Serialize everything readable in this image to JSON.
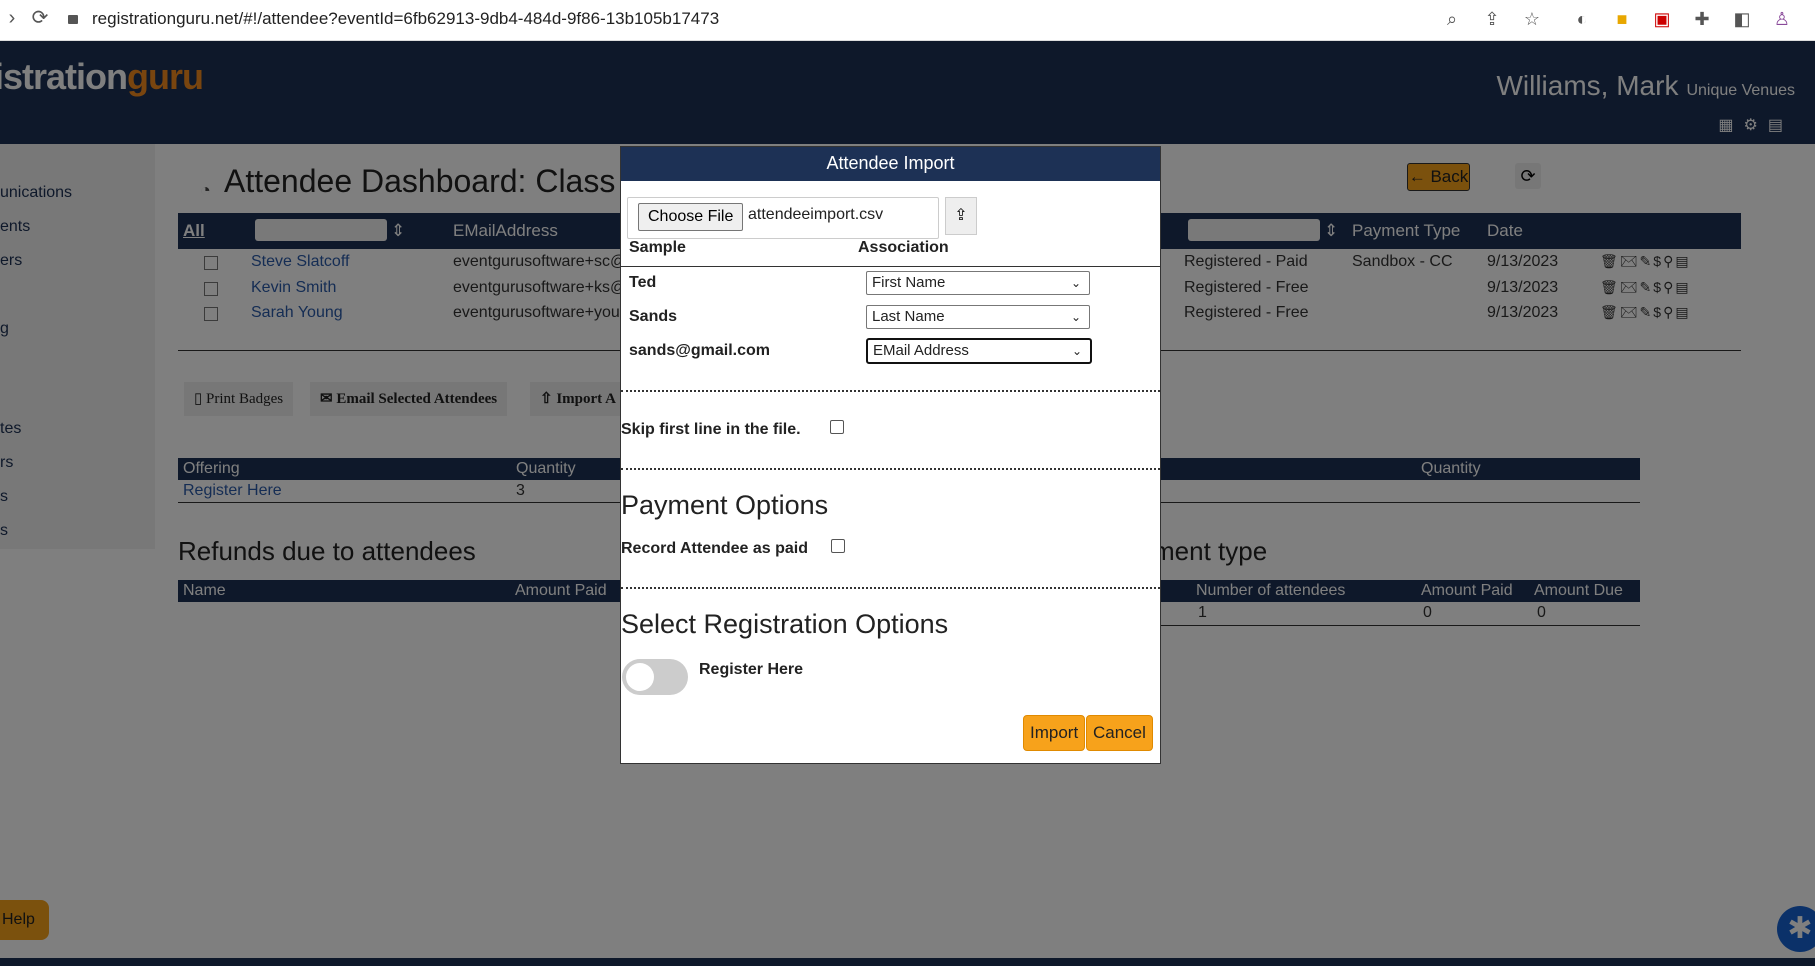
{
  "browser": {
    "url": "registrationguru.net/#!/attendee?eventId=6fb62913-9db4-484d-9f86-13b105b17473"
  },
  "app": {
    "logo_main": "istration",
    "logo_guru": "guru",
    "user_name": "Williams, Mark",
    "org": "Unique Venues",
    "sidebar": [
      "unications",
      "ents",
      "ers",
      "g",
      "tes",
      "rs",
      "s",
      "s"
    ],
    "page_title": "Attendee Dashboard: Class",
    "back_label": "Back",
    "grid": {
      "all_label": "All",
      "col_email": "EMailAddress",
      "col_payment": "Payment Type",
      "col_date": "Date",
      "rows": [
        {
          "name": "Steve Slatcoff",
          "email": "eventgurusoftware+sc@",
          "status": "Registered - Paid",
          "payment": "Sandbox - CC",
          "date": "9/13/2023"
        },
        {
          "name": "Kevin Smith",
          "email": "eventgurusoftware+ks@",
          "status": "Registered - Free",
          "payment": "",
          "date": "9/13/2023"
        },
        {
          "name": "Sarah Young",
          "email": "eventgurusoftware+you",
          "status": "Registered - Free",
          "payment": "",
          "date": "9/13/2023"
        }
      ]
    },
    "actions": {
      "print_badges": "Print Badges",
      "email_selected": "Email Selected Attendees",
      "import": "Import A"
    },
    "offering_table": {
      "col_offering": "Offering",
      "col_quantity": "Quantity",
      "col_quantity2": "Quantity",
      "row_offering": "Register Here",
      "row_quantity": "3"
    },
    "refunds": {
      "title": "Refunds due to attendees",
      "col_name": "Name",
      "col_amount_paid": "Amount Paid"
    },
    "payment_type": {
      "title": "yment type",
      "col_number": "Number of attendees",
      "col_amount_paid": "Amount Paid",
      "col_amount_due": "Amount Due",
      "row_number": "1",
      "row_paid": "0",
      "row_due": "0"
    },
    "help_label": "Help"
  },
  "modal": {
    "title": "Attendee Import",
    "choose_file": "Choose File",
    "file_name": "attendeeimport.csv",
    "col_sample": "Sample",
    "col_association": "Association",
    "mappings": [
      {
        "sample": "Ted",
        "association": "First Name"
      },
      {
        "sample": "Sands",
        "association": "Last Name"
      },
      {
        "sample": "sands@gmail.com",
        "association": "EMail Address"
      }
    ],
    "skip_first_line": "Skip first line in the file.",
    "payment_options_title": "Payment Options",
    "record_paid": "Record Attendee as paid",
    "registration_options_title": "Select Registration Options",
    "registration_option": "Register Here",
    "import_label": "Import",
    "cancel_label": "Cancel"
  },
  "colors": {
    "navy": "#1d3155",
    "orange": "#f7a21b"
  }
}
